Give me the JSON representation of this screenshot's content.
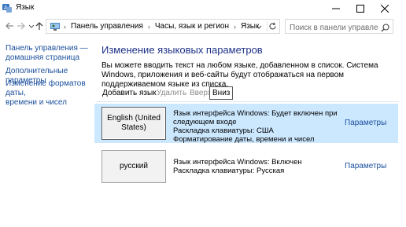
{
  "window": {
    "title": "Язык"
  },
  "address_bar": {
    "crumbs": [
      "Панель управления",
      "Часы, язык и регион",
      "Язык"
    ],
    "search_placeholder": "Поиск в панели управления"
  },
  "sidebar": {
    "items": [
      {
        "label": "Панель управления —\nдомашняя страница"
      },
      {
        "label": "Дополнительные параметры"
      },
      {
        "label": "Изменение форматов даты,\nвремени и чисел"
      }
    ]
  },
  "main": {
    "heading": "Изменение языковых параметров",
    "description": "Вы можете вводить текст на любом языке, добавленном в список. Система Windows, приложения и веб-сайты будут отображаться на первом поддерживаемом языке из списка."
  },
  "toolbar": {
    "add_label": "Добавить язык",
    "remove_label": "Удалить",
    "up_label": "Вверх",
    "down_label": "Вниз"
  },
  "languages": [
    {
      "name": "English (United States)",
      "selected": true,
      "lines": [
        "Язык интерфейса Windows: Будет включен при следующем входе",
        "Раскладка клавиатуры: США",
        "Форматирование даты, времени и чисел"
      ],
      "options_label": "Параметры"
    },
    {
      "name": "русский",
      "selected": false,
      "lines": [
        "Язык интерфейса Windows: Включен",
        "Раскладка клавиатуры: Русская"
      ],
      "options_label": "Параметры"
    }
  ],
  "colors": {
    "link": "#1a4f9c",
    "heading": "#1e3287",
    "selected_row": "#cce8ff",
    "disabled_text": "#8c8c8c"
  }
}
